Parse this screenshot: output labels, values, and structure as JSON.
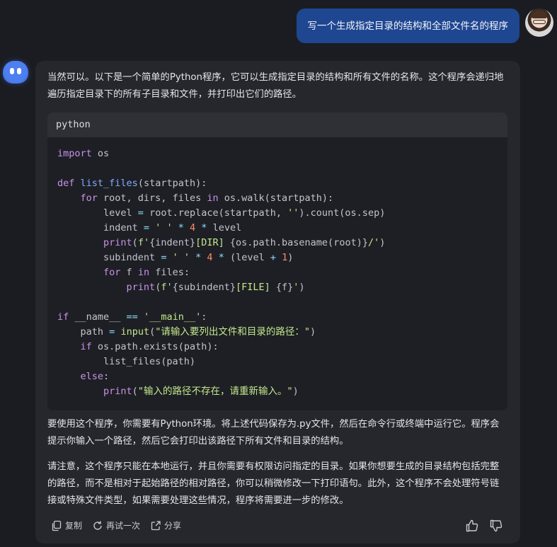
{
  "user_message": "写一个生成指定目录的结构和全部文件名的程序",
  "response": {
    "intro": "当然可以。以下是一个简单的Python程序，它可以生成指定目录的结构和所有文件的名称。这个程序会递归地遍历指定目录下的所有子目录和文件，并打印出它们的路径。",
    "code_language": "python",
    "code_lines": [
      [
        [
          "kw",
          "import"
        ],
        [
          "tx",
          " os"
        ]
      ],
      [],
      [
        [
          "kw",
          "def"
        ],
        [
          "tx",
          " "
        ],
        [
          "fn",
          "list_files"
        ],
        [
          "tx",
          "(startpath):"
        ]
      ],
      [
        [
          "tx",
          "    "
        ],
        [
          "kw",
          "for"
        ],
        [
          "tx",
          " root, dirs, files "
        ],
        [
          "kw",
          "in"
        ],
        [
          "tx",
          " os.walk(startpath):"
        ]
      ],
      [
        [
          "tx",
          "        level "
        ],
        [
          "op",
          "="
        ],
        [
          "tx",
          " root.replace(startpath, "
        ],
        [
          "str",
          "''"
        ],
        [
          "tx",
          ").count(os.sep)"
        ]
      ],
      [
        [
          "tx",
          "        indent "
        ],
        [
          "op",
          "="
        ],
        [
          "tx",
          " "
        ],
        [
          "str",
          "' '"
        ],
        [
          "tx",
          " "
        ],
        [
          "op",
          "*"
        ],
        [
          "tx",
          " "
        ],
        [
          "num",
          "4"
        ],
        [
          "tx",
          " "
        ],
        [
          "op",
          "*"
        ],
        [
          "tx",
          " level"
        ]
      ],
      [
        [
          "tx",
          "        "
        ],
        [
          "bi",
          "print"
        ],
        [
          "tx",
          "("
        ],
        [
          "str",
          "f'"
        ],
        [
          "tx",
          "{indent}"
        ],
        [
          "str",
          "[DIR] "
        ],
        [
          "tx",
          "{os.path.basename(root)}"
        ],
        [
          "str",
          "/'"
        ],
        [
          "tx",
          ")"
        ]
      ],
      [
        [
          "tx",
          "        subindent "
        ],
        [
          "op",
          "="
        ],
        [
          "tx",
          " "
        ],
        [
          "str",
          "' '"
        ],
        [
          "tx",
          " "
        ],
        [
          "op",
          "*"
        ],
        [
          "tx",
          " "
        ],
        [
          "num",
          "4"
        ],
        [
          "tx",
          " "
        ],
        [
          "op",
          "*"
        ],
        [
          "tx",
          " (level "
        ],
        [
          "op",
          "+"
        ],
        [
          "tx",
          " "
        ],
        [
          "num",
          "1"
        ],
        [
          "tx",
          ")"
        ]
      ],
      [
        [
          "tx",
          "        "
        ],
        [
          "kw",
          "for"
        ],
        [
          "tx",
          " f "
        ],
        [
          "kw",
          "in"
        ],
        [
          "tx",
          " files:"
        ]
      ],
      [
        [
          "tx",
          "            "
        ],
        [
          "bi",
          "print"
        ],
        [
          "tx",
          "("
        ],
        [
          "str",
          "f'"
        ],
        [
          "tx",
          "{subindent}"
        ],
        [
          "str",
          "[FILE] "
        ],
        [
          "tx",
          "{f}"
        ],
        [
          "str",
          "'"
        ],
        [
          "tx",
          ")"
        ]
      ],
      [],
      [
        [
          "kw",
          "if"
        ],
        [
          "tx",
          " __name__ "
        ],
        [
          "op",
          "=="
        ],
        [
          "tx",
          " "
        ],
        [
          "str",
          "'__main__'"
        ],
        [
          "tx",
          ":"
        ]
      ],
      [
        [
          "tx",
          "    path "
        ],
        [
          "op",
          "="
        ],
        [
          "tx",
          " "
        ],
        [
          "str",
          "input"
        ],
        [
          "tx",
          "("
        ],
        [
          "str",
          "\"请输入要列出文件和目录的路径：\""
        ],
        [
          "tx",
          ")"
        ]
      ],
      [
        [
          "tx",
          "    "
        ],
        [
          "kw",
          "if"
        ],
        [
          "tx",
          " os.path.exists(path):"
        ]
      ],
      [
        [
          "tx",
          "        list_files(path)"
        ]
      ],
      [
        [
          "tx",
          "    "
        ],
        [
          "kw",
          "else"
        ],
        [
          "tx",
          ":"
        ]
      ],
      [
        [
          "tx",
          "        "
        ],
        [
          "bi",
          "print"
        ],
        [
          "tx",
          "("
        ],
        [
          "str",
          "\"输入的路径不存在，请重新输入。\""
        ],
        [
          "tx",
          ")"
        ]
      ]
    ],
    "para2": "要使用这个程序，你需要有Python环境。将上述代码保存为.py文件，然后在命令行或终端中运行它。程序会提示你输入一个路径，然后它会打印出该路径下所有文件和目录的结构。",
    "para3": "请注意，这个程序只能在本地运行，并且你需要有权限访问指定的目录。如果你想要生成的目录结构包括完整的路径，而不是相对于起始路径的相对路径，你可以稍微修改一下打印语句。此外，这个程序不会处理符号链接或特殊文件类型，如果需要处理这些情况，程序将需要进一步的修改。"
  },
  "actions": {
    "copy": "复制",
    "retry": "再试一次",
    "share": "分享"
  },
  "icons": {
    "copy": "copy-icon",
    "retry": "refresh-icon",
    "share": "share-icon",
    "like": "thumbs-up-icon",
    "dislike": "thumbs-down-icon"
  },
  "colors": {
    "user_bubble": "#1f4690",
    "card": "#26272d",
    "background": "#1b1c21"
  }
}
